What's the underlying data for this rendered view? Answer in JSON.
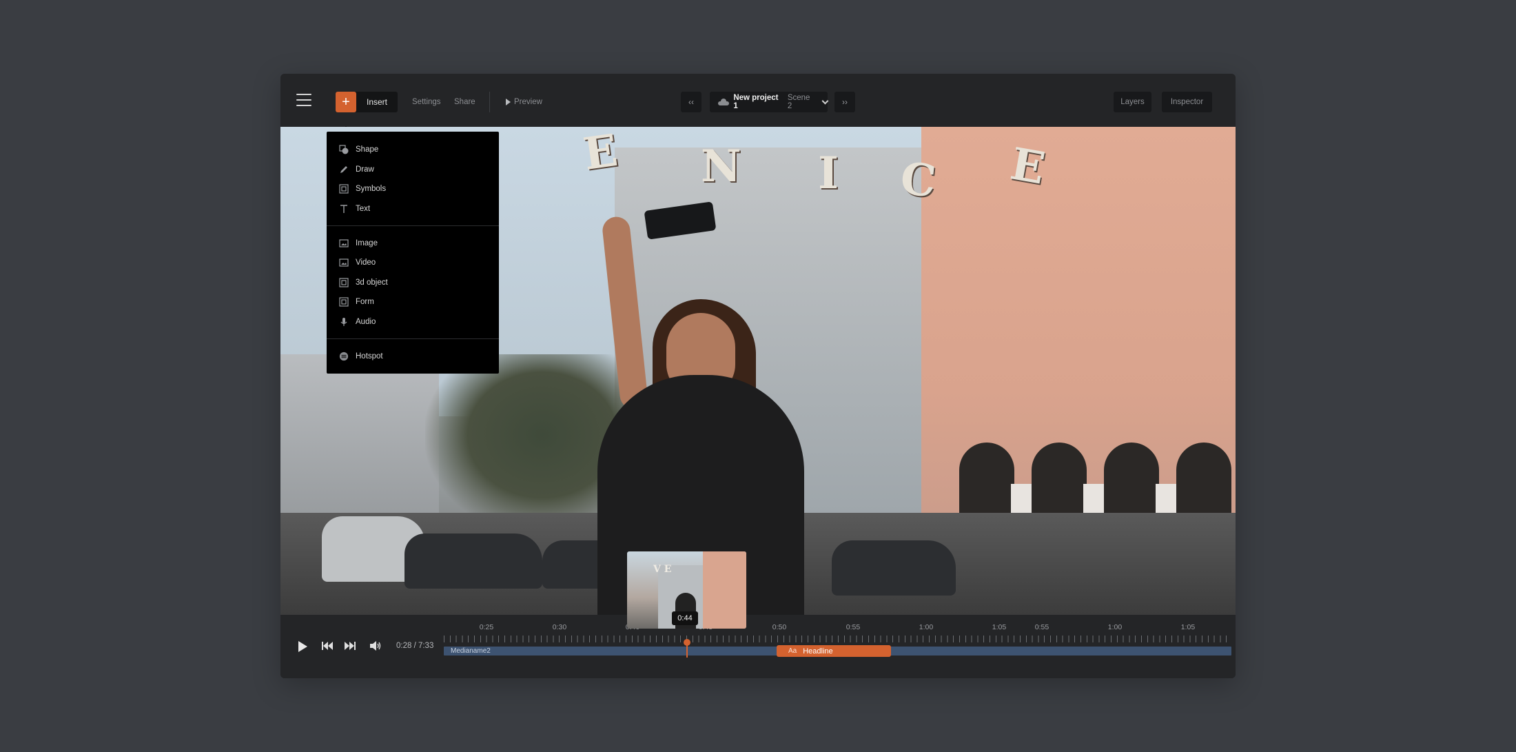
{
  "toolbar": {
    "insert_label": "Insert",
    "settings_label": "Settings",
    "share_label": "Share",
    "preview_label": "Preview",
    "prev_label": "‹‹",
    "next_label": "››",
    "project_name": "New project 1",
    "scene_name": "Scene 2",
    "layers_label": "Layers",
    "inspector_label": "Inspector"
  },
  "insert_menu": {
    "group1": [
      {
        "label": "Shape",
        "icon": "shape-icon"
      },
      {
        "label": "Draw",
        "icon": "pencil-icon"
      },
      {
        "label": "Symbols",
        "icon": "symbols-icon"
      },
      {
        "label": "Text",
        "icon": "text-icon"
      }
    ],
    "group2": [
      {
        "label": "Image",
        "icon": "image-icon"
      },
      {
        "label": "Video",
        "icon": "video-icon"
      },
      {
        "label": "3d object",
        "icon": "cube-icon"
      },
      {
        "label": "Form",
        "icon": "form-icon"
      },
      {
        "label": "Audio",
        "icon": "microphone-icon"
      }
    ],
    "group3": [
      {
        "label": "Hotspot",
        "icon": "hotspot-icon"
      }
    ]
  },
  "canvas": {
    "sign_letters": [
      "E",
      "N",
      "I",
      "C",
      "E"
    ]
  },
  "timeline": {
    "current_time": "0:28 / 7:33",
    "hover_time": "0:44",
    "ruler_labels": [
      "0:25",
      "0:30",
      "0:40",
      "0:45",
      "0:50",
      "0:55",
      "1:00",
      "1:05",
      "0:55",
      "1:00",
      "1:05"
    ],
    "media_track_label": "Medianame2",
    "clip_prefix": "Aa",
    "clip_label": "Headline"
  },
  "colors": {
    "accent": "#d4622f",
    "track": "#3d5371",
    "background": "#3a3d42",
    "panel": "#242527"
  }
}
